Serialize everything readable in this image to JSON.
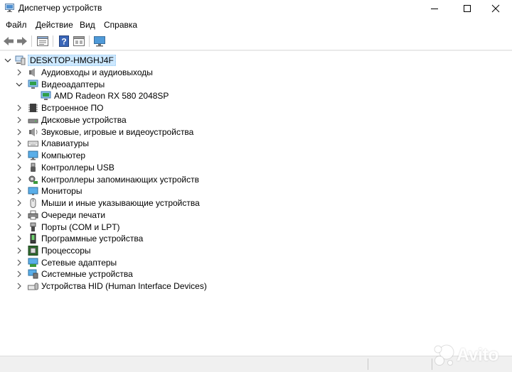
{
  "window": {
    "title": "Диспетчер устройств",
    "minimize_icon": "minimize-icon",
    "maximize_icon": "maximize-icon",
    "close_icon": "close-icon"
  },
  "menu": [
    {
      "label": "Файл"
    },
    {
      "label": "Действие"
    },
    {
      "label": "Вид"
    },
    {
      "label": "Справка"
    }
  ],
  "toolbar": {
    "buttons": [
      "back-icon",
      "forward-icon",
      "properties-icon",
      "help-icon",
      "show-hidden-icon",
      "monitor-scan-icon"
    ]
  },
  "tree": {
    "root": {
      "label": "DESKTOP-HMGHJ4F",
      "expanded": true,
      "icon": "computer-icon"
    },
    "categories": [
      {
        "label": "Аудиовходы и аудиовыходы",
        "icon": "audio-io-icon",
        "expanded": false
      },
      {
        "label": "Видеоадаптеры",
        "icon": "display-adapter-icon",
        "expanded": true
      },
      {
        "label": "AMD Radeon RX 580 2048SP",
        "icon": "display-adapter-icon",
        "child": true
      },
      {
        "label": "Встроенное ПО",
        "icon": "firmware-icon",
        "expanded": false
      },
      {
        "label": "Дисковые устройства",
        "icon": "disk-drive-icon",
        "expanded": false
      },
      {
        "label": "Звуковые, игровые и видеоустройства",
        "icon": "sound-icon",
        "expanded": false
      },
      {
        "label": "Клавиатуры",
        "icon": "keyboard-icon",
        "expanded": false
      },
      {
        "label": "Компьютер",
        "icon": "computer-monitor-icon",
        "expanded": false
      },
      {
        "label": "Контроллеры USB",
        "icon": "usb-controller-icon",
        "expanded": false
      },
      {
        "label": "Контроллеры запоминающих устройств",
        "icon": "storage-controller-icon",
        "expanded": false
      },
      {
        "label": "Мониторы",
        "icon": "monitor-icon",
        "expanded": false
      },
      {
        "label": "Мыши и иные указывающие устройства",
        "icon": "mouse-icon",
        "expanded": false
      },
      {
        "label": "Очереди печати",
        "icon": "printer-icon",
        "expanded": false
      },
      {
        "label": "Порты (COM и LPT)",
        "icon": "port-icon",
        "expanded": false
      },
      {
        "label": "Программные устройства",
        "icon": "software-device-icon",
        "expanded": false
      },
      {
        "label": "Процессоры",
        "icon": "processor-icon",
        "expanded": false
      },
      {
        "label": "Сетевые адаптеры",
        "icon": "network-adapter-icon",
        "expanded": false
      },
      {
        "label": "Системные устройства",
        "icon": "system-device-icon",
        "expanded": false
      },
      {
        "label": "Устройства HID (Human Interface Devices)",
        "icon": "hid-icon",
        "expanded": false
      }
    ]
  },
  "watermark": {
    "text": "Avito",
    "icon": "avito-logo-icon"
  }
}
